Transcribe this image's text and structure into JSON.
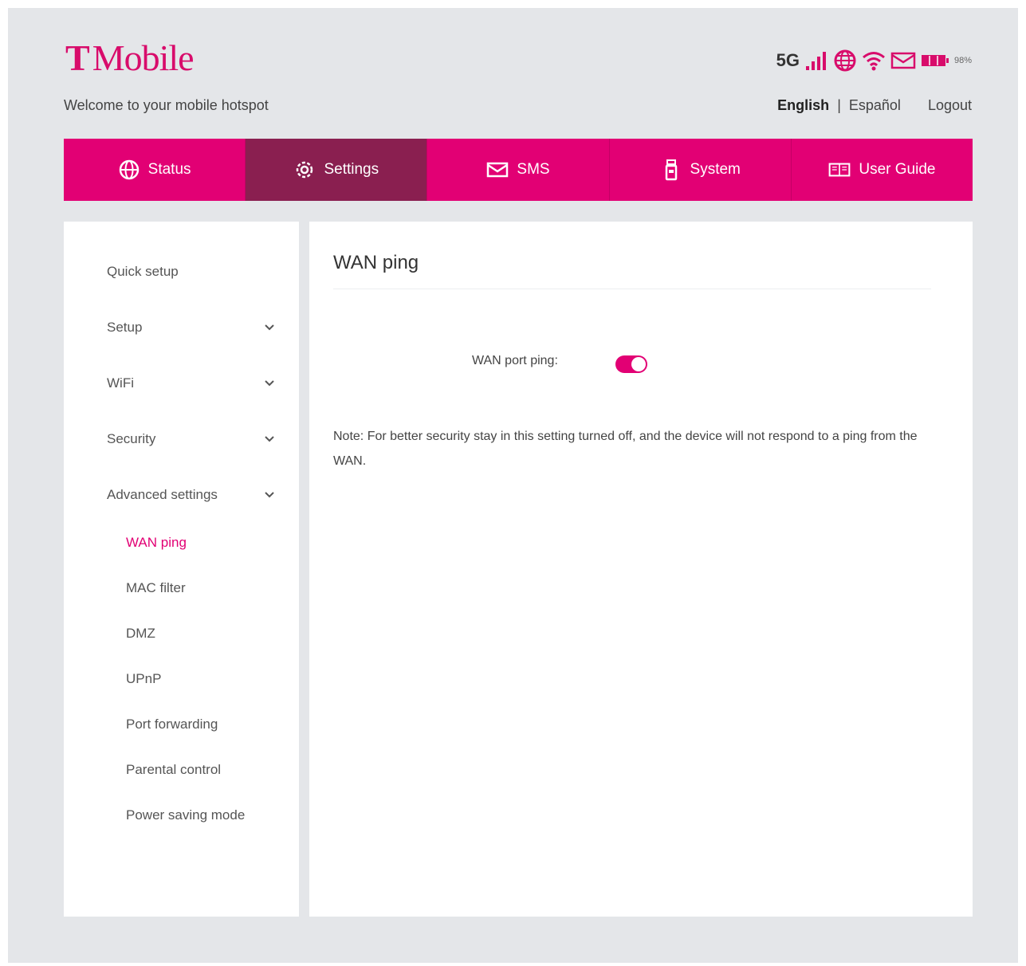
{
  "brand": {
    "t": "T",
    "name": "Mobile"
  },
  "welcome": "Welcome to your mobile hotspot",
  "status": {
    "network": "5G",
    "battery_pct": "98%",
    "signal_level": 1.0
  },
  "lang": {
    "english": "English",
    "sep": "|",
    "espanol": "Español",
    "logout": "Logout"
  },
  "nav": {
    "status": "Status",
    "settings": "Settings",
    "sms": "SMS",
    "system": "System",
    "guide": "User Guide"
  },
  "sidebar": {
    "quick_setup": "Quick setup",
    "setup": "Setup",
    "wifi": "WiFi",
    "security": "Security",
    "advanced": "Advanced settings",
    "sub": {
      "wan_ping": "WAN ping",
      "mac_filter": "MAC filter",
      "dmz": "DMZ",
      "upnp": "UPnP",
      "port_forwarding": "Port forwarding",
      "parental_control": "Parental control",
      "power_saving": "Power saving mode"
    }
  },
  "content": {
    "title": "WAN ping",
    "field_label": "WAN port ping:",
    "toggle_on": true,
    "note": "Note: For better security stay in this setting turned off, and the device will not respond to a ping from the WAN."
  },
  "colors": {
    "accent": "#e20074",
    "nav_active": "#8a1f50",
    "background": "#e4e6e9"
  }
}
